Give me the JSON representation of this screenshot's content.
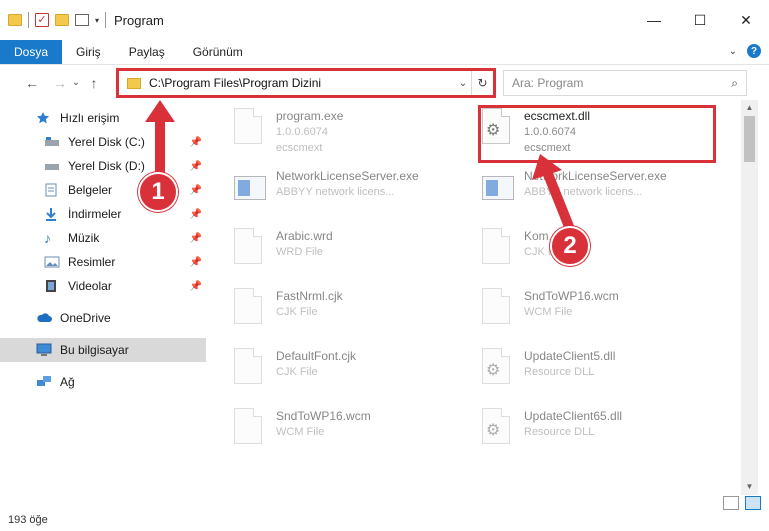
{
  "window": {
    "title": "Program",
    "minimize": "—",
    "maximize": "☐",
    "close": "✕"
  },
  "ribbon": {
    "tabs": [
      "Dosya",
      "Giriş",
      "Paylaş",
      "Görünüm"
    ],
    "help": "?",
    "expand": "⌄"
  },
  "nav": {
    "back": "←",
    "forward": "→",
    "recent": "⌄",
    "up": "↑",
    "address": "C:\\Program Files\\Program Dizini",
    "address_dropdown": "⌄",
    "refresh": "↻",
    "search_placeholder": "Ara: Program",
    "search_icon": "⌕"
  },
  "sidebar": {
    "items": [
      {
        "label": "Hızlı erişim",
        "icon": "star-icon",
        "pinned": false
      },
      {
        "label": "Yerel Disk (C:)",
        "icon": "drive-icon",
        "pinned": true
      },
      {
        "label": "Yerel Disk (D:)",
        "icon": "drive-icon",
        "pinned": true
      },
      {
        "label": "Belgeler",
        "icon": "documents-icon",
        "pinned": true
      },
      {
        "label": "İndirmeler",
        "icon": "download-icon",
        "pinned": true
      },
      {
        "label": "Müzik",
        "icon": "music-icon",
        "pinned": true
      },
      {
        "label": "Resimler",
        "icon": "pictures-icon",
        "pinned": true
      },
      {
        "label": "Videolar",
        "icon": "video-icon",
        "pinned": true
      },
      {
        "label": "OneDrive",
        "icon": "cloud-icon",
        "pinned": false
      },
      {
        "label": "Bu bilgisayar",
        "icon": "computer-icon",
        "pinned": false
      },
      {
        "label": "Ağ",
        "icon": "network-icon",
        "pinned": false
      }
    ]
  },
  "files": [
    {
      "name": "program.exe",
      "line2": "1.0.0.6074",
      "line3": "ecscmext",
      "kind": "exe",
      "faded": true
    },
    {
      "name": "ecscmext.dll",
      "line2": "1.0.0.6074",
      "line3": "ecscmext",
      "kind": "dll",
      "faded": false
    },
    {
      "name": "NetworkLicenseServer.exe",
      "line2": "ABBYY network licens...",
      "line3": "",
      "kind": "exe",
      "faded": true
    },
    {
      "name": "NetworkLicenseServer.exe",
      "line2": "ABBYY network licens...",
      "line3": "",
      "kind": "exe",
      "faded": true
    },
    {
      "name": "Arabic.wrd",
      "line2": "WRD File",
      "line3": "",
      "kind": "doc",
      "faded": true
    },
    {
      "name": "Kom...",
      "line2": "CJK File",
      "line3": "",
      "kind": "doc",
      "faded": true
    },
    {
      "name": "FastNrml.cjk",
      "line2": "CJK File",
      "line3": "",
      "kind": "doc",
      "faded": true
    },
    {
      "name": "SndToWP16.wcm",
      "line2": "WCM File",
      "line3": "",
      "kind": "doc",
      "faded": true
    },
    {
      "name": "DefaultFont.cjk",
      "line2": "CJK File",
      "line3": "",
      "kind": "doc",
      "faded": true
    },
    {
      "name": "UpdateClient5.dll",
      "line2": "Resource DLL",
      "line3": "",
      "kind": "dll",
      "faded": true
    },
    {
      "name": "SndToWP16.wcm",
      "line2": "WCM File",
      "line3": "",
      "kind": "doc",
      "faded": true
    },
    {
      "name": "UpdateClient65.dll",
      "line2": "Resource DLL",
      "line3": "",
      "kind": "dll",
      "faded": true
    }
  ],
  "annotations": {
    "step1": "1",
    "step2": "2",
    "color": "#d9313a"
  },
  "status": {
    "count": "193 öğe"
  },
  "colors": {
    "accent": "#1979ca",
    "highlight": "#d9313a"
  }
}
